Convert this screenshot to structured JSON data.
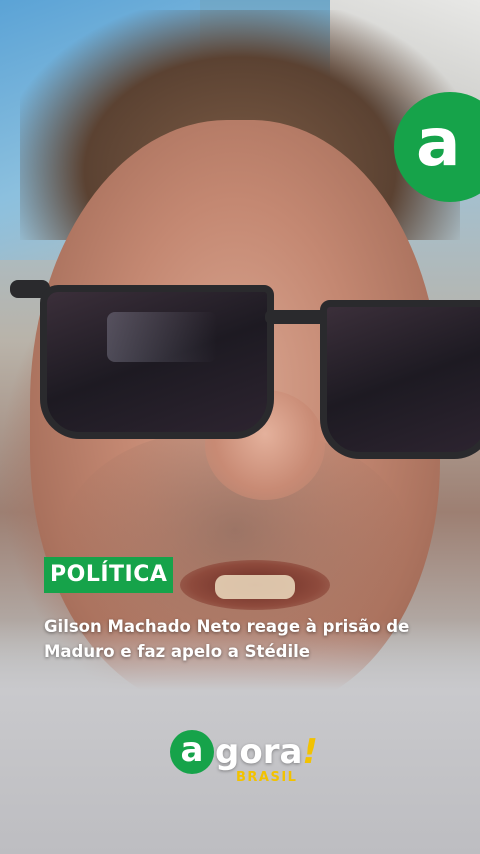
{
  "overlay": {
    "corner_logo_letter": "a",
    "category_tag": "POLÍTICA",
    "headline": "Gilson Machado Neto reage à prisão de Maduro e faz apelo a Stédile"
  },
  "brand": {
    "first_letter": "a",
    "rest": "gora",
    "exclamation": "!",
    "subtitle": "BRASIL"
  },
  "colors": {
    "brand_green": "#16a34a",
    "brand_yellow": "#f2c200",
    "text_white": "#ffffff"
  },
  "icons": {
    "corner_logo": "agora-a-logo-icon"
  }
}
